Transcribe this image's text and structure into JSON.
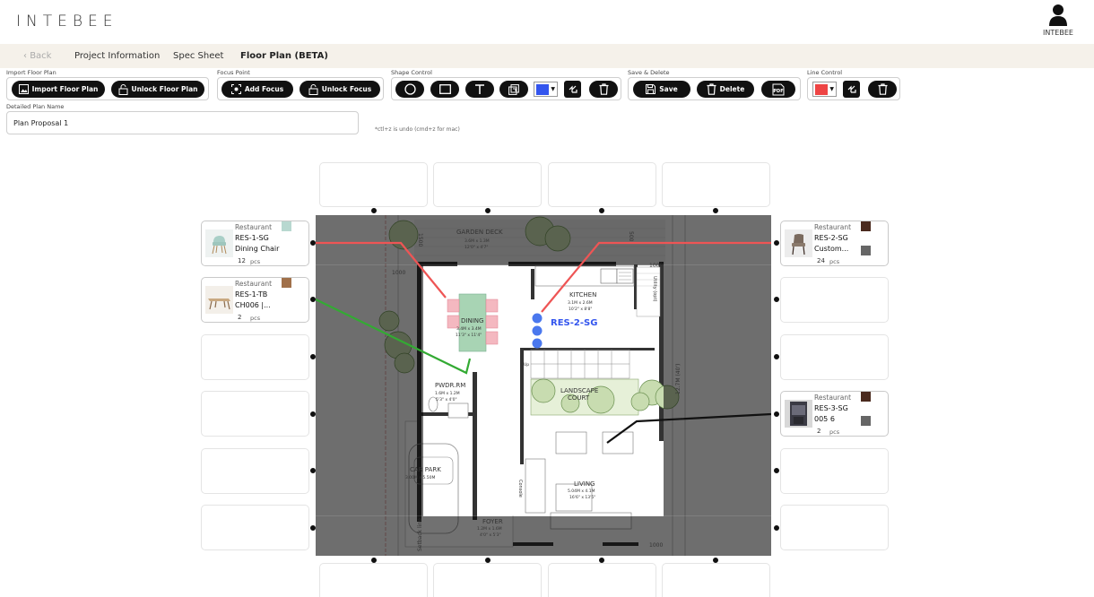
{
  "app": {
    "logo": "INTEBEE",
    "user_name": "INTEBEE"
  },
  "nav": {
    "back": "Back",
    "project_info": "Project Information",
    "spec_sheet": "Spec Sheet",
    "floor_plan": "Floor Plan (BETA)"
  },
  "toolbar": {
    "import_group": "Import Floor Plan",
    "import_btn": "Import Floor Plan",
    "unlock_plan_btn": "Unlock Floor Plan",
    "focus_group": "Focus Point",
    "add_focus_btn": "Add Focus",
    "unlock_focus_btn": "Unlock Focus",
    "shape_group": "Shape Control",
    "shape_color": "#3355ee",
    "save_group": "Save & Delete",
    "save_btn": "Save",
    "delete_btn": "Delete",
    "pdf_label": "PDF",
    "line_group": "Line Control",
    "line_color": "#ee4444"
  },
  "plan_name": {
    "label": "Detailed Plan Name",
    "value": "Plan Proposal 1"
  },
  "hint": "*ctl+z is undo (cmd+z for mac)",
  "cards": [
    {
      "category": "Restaurant",
      "code": "RES-1-SG",
      "name": "Dining Chair",
      "qty": "12",
      "unit": "pcs",
      "swatch": "#b8d8d0"
    },
    {
      "category": "Restaurant",
      "code": "RES-1-TB",
      "name": "CH006 |...",
      "qty": "2",
      "unit": "pcs",
      "swatch": "#a0704a"
    },
    {
      "category": "Restaurant",
      "code": "RES-2-SG",
      "name": "Custom...",
      "qty": "24",
      "unit": "pcs",
      "swatch": "#4a2a1e",
      "swatch2": "#666666"
    },
    {
      "category": "Restaurant",
      "code": "RES-3-SG",
      "name": "005 6",
      "qty": "2",
      "unit": "pcs",
      "swatch": "#4a2a1e",
      "swatch2": "#666666"
    }
  ],
  "plan": {
    "rooms": {
      "garden": "GARDEN DECK",
      "garden_dim": "3.6M x 1.3M",
      "garden_dim2": "12'0\" x 4'7\"",
      "kitchen": "KITCHEN",
      "kitchen_dim": "3.1M x 2.6M",
      "kitchen_dim2": "10'2\" x 8'8\"",
      "dining": "DINING",
      "dining_dim": "3.4M x 3.4M",
      "dining_dim2": "11'3\" x 11'4\"",
      "landscape": "LANDSCAPE",
      "landscape2": "COURT",
      "pwdr": "PWDR.RM",
      "pwdr_dim": "1.6M x 1.2M",
      "pwdr_dim2": "5'3\" x 4'0\"",
      "carpark": "CAR PARK",
      "carpark_dim": "3.00M x 5.50M",
      "living": "LIVING",
      "living_dim": "5.04M x 4.1M",
      "living_dim2": "16'6\" x 13'5\"",
      "foyer": "FOYER",
      "foyer_dim": "1.2M x 1.6M",
      "foyer_dim2": "4'0\" x 5'3\"",
      "utility": "Utility (opt)",
      "setback": "Setback line",
      "console": "Console",
      "up": "Up",
      "dim_1000a": "1000",
      "dim_1500": "1500",
      "dim_500": "500",
      "dim_1000b": "1000",
      "dim_1000c": "1000",
      "dim_side": "12.7M (40')"
    },
    "marker_label": "RES-2-SG"
  }
}
